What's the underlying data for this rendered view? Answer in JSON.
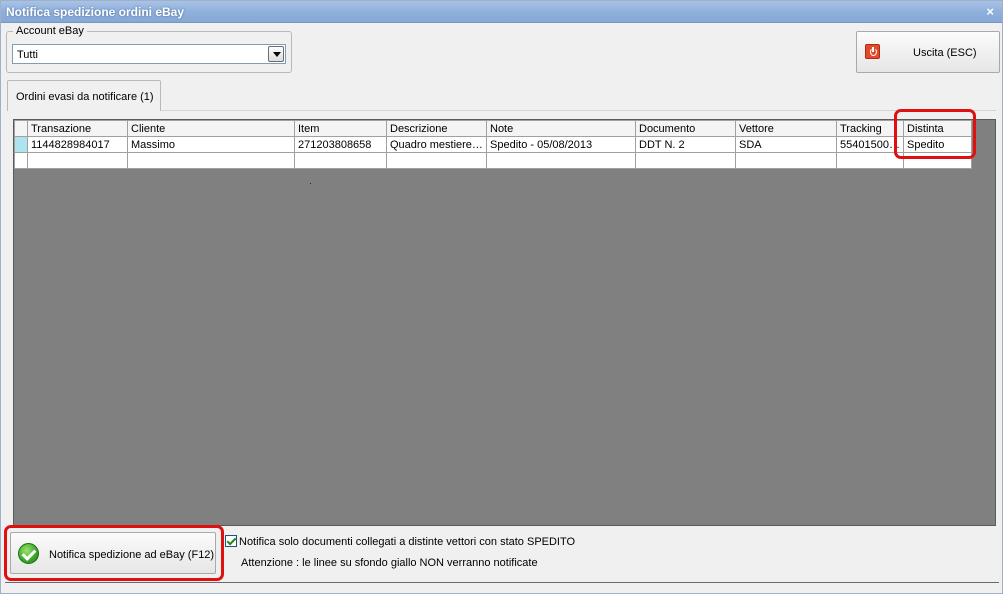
{
  "window": {
    "title": "Notifica spedizione ordini eBay",
    "close_glyph": "×"
  },
  "account": {
    "group_label": "Account eBay",
    "selected_value": "Tutti"
  },
  "exit_button": {
    "label": "Uscita (ESC)",
    "icon": "power-icon"
  },
  "tabs": [
    {
      "label": "Ordini evasi da notificare (1)",
      "active": true
    }
  ],
  "grid": {
    "columns": [
      "Transazione",
      "Cliente",
      "Item",
      "Descrizione",
      "Note",
      "Documento",
      "Vettore",
      "Tracking",
      "Distinta"
    ],
    "rows": [
      [
        "1144828984017",
        "Massimo",
        "271203808658",
        "Quadro mestiere…",
        "Spedito - 05/08/2013",
        "DDT N. 2",
        "SDA",
        "55401500…",
        "Spedito"
      ]
    ]
  },
  "notify_button": {
    "label": "Notifica spedizione ad eBay (F12)",
    "icon": "check-circle-icon"
  },
  "option": {
    "checked": true,
    "label": "Notifica solo documenti  collegati a distinte vettori con stato SPEDITO"
  },
  "warning": "Attenzione : le linee su sfondo giallo NON verranno notificate",
  "colors": {
    "titlebar": "#8fb0dc",
    "highlight": "#e01010",
    "grid_background": "#808080",
    "row_indicator": "#aee4ee"
  }
}
